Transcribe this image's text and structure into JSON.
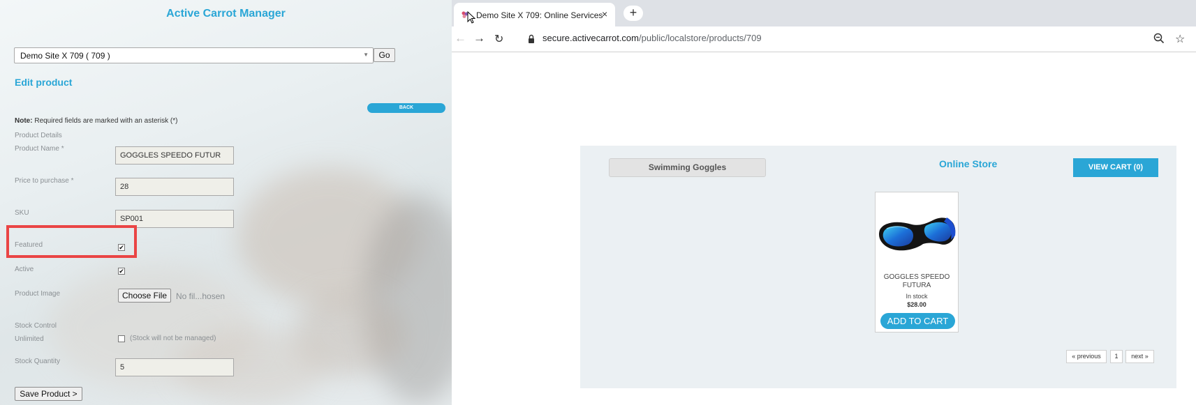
{
  "admin": {
    "app_title": "Active Carrot Manager",
    "site_select": {
      "value": "Demo Site X 709 ( 709 )"
    },
    "go_label": "Go",
    "edit_title": "Edit product",
    "back_label": "BACK",
    "note_bold": "Note:",
    "note_text": " Required fields are marked with an asterisk (*)",
    "section_label": "Product Details",
    "fields": {
      "product_name": {
        "label": "Product Name *",
        "value": "GOGGLES SPEEDO FUTUR"
      },
      "price": {
        "label": "Price to purchase *",
        "value": "28"
      },
      "sku": {
        "label": "SKU",
        "value": "SP001"
      },
      "featured": {
        "label": "Featured",
        "checked": true
      },
      "active": {
        "label": "Active",
        "checked": true
      },
      "product_image": {
        "label": "Product Image",
        "button": "Choose File",
        "status": "No fil...hosen"
      },
      "stock_control_label": "Stock Control",
      "unlimited": {
        "label": "Unlimited",
        "checked": false,
        "note": "(Stock will not be managed)"
      },
      "stock_quantity": {
        "label": "Stock Quantity",
        "value": "5"
      }
    },
    "save_label": "Save Product >",
    "accent_color": "#2aa6d6",
    "highlight_color": "#ea4545"
  },
  "browser": {
    "tab_title": "Demo Site X 709: Online Services",
    "tab_close": "×",
    "new_tab": "+",
    "url_host": "secure.activecarrot.com",
    "url_path": "/public/localstore/products/709",
    "store": {
      "category_button": "Swimming Goggles",
      "title": "Online Store",
      "view_cart": "VIEW CART (0)",
      "product": {
        "name": "GOGGLES SPEEDO FUTURA",
        "stock": "In stock",
        "price": "$28.00",
        "add_to_cart": "ADD TO CART"
      },
      "pagination": {
        "previous": "« previous",
        "page": "1",
        "next": "next »"
      }
    }
  }
}
